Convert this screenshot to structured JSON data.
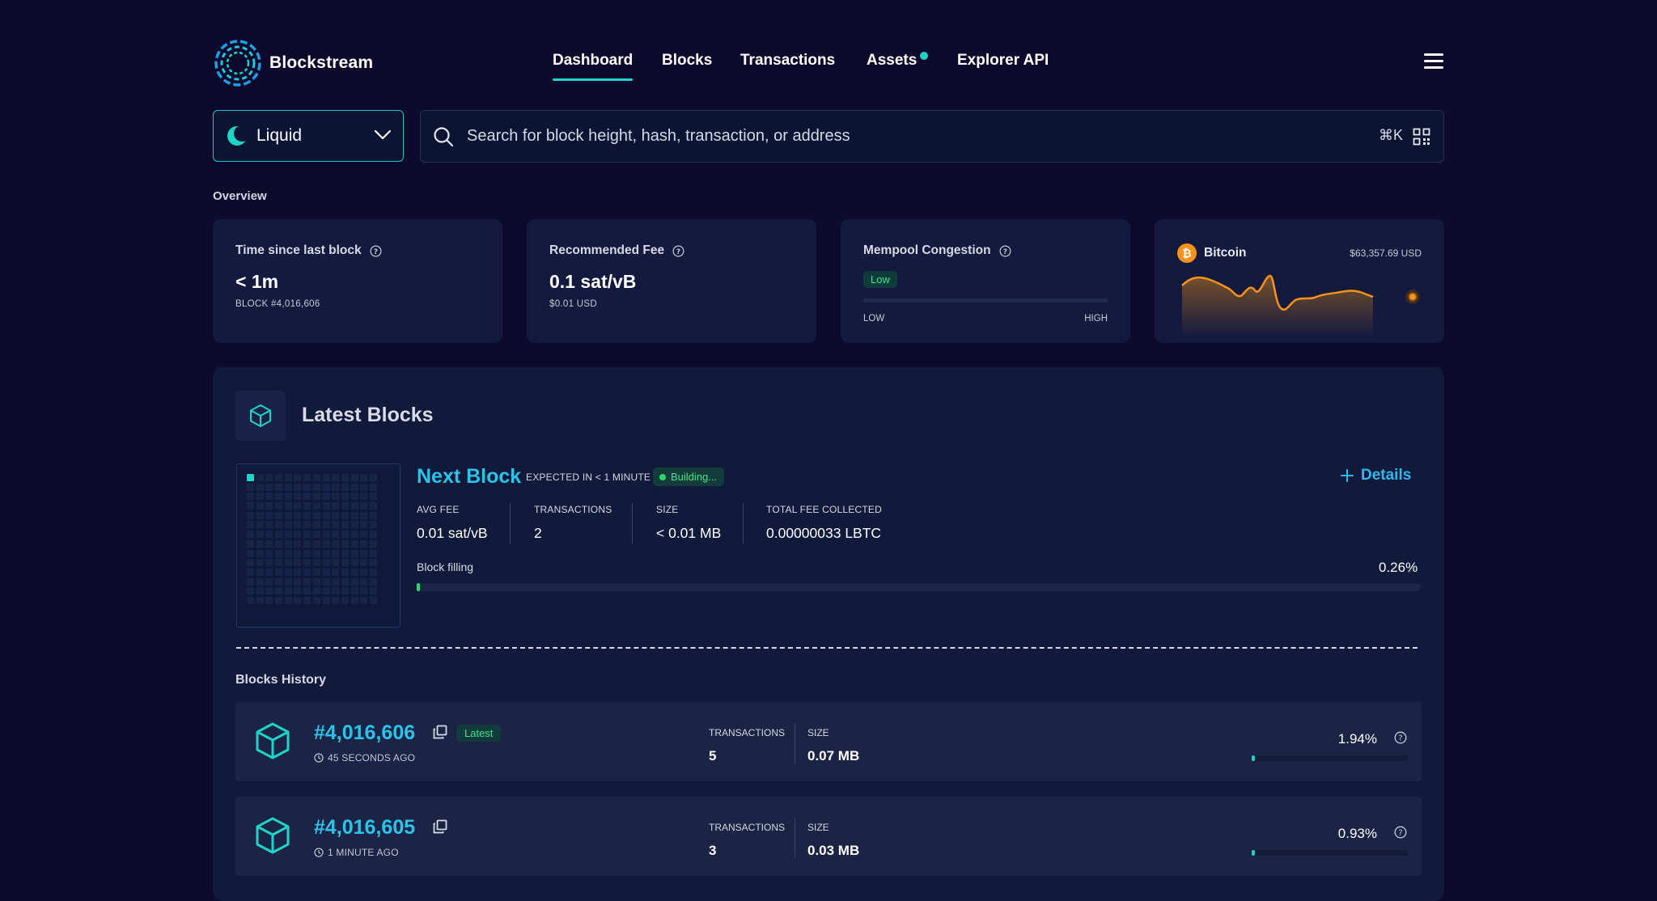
{
  "brand": {
    "name": "Blockstream"
  },
  "nav": {
    "items": [
      "Dashboard",
      "Blocks",
      "Transactions",
      "Assets",
      "Explorer API"
    ],
    "active": "Dashboard"
  },
  "network": {
    "selected": "Liquid"
  },
  "search": {
    "placeholder": "Search for block height, hash, transaction, or address",
    "shortcut": "⌘K"
  },
  "overview": {
    "title": "Overview",
    "cards": {
      "time_since": {
        "title": "Time since last block",
        "value": "< 1m",
        "sub": "BLOCK #4,016,606"
      },
      "fee": {
        "title": "Recommended Fee",
        "value": "0.1 sat/vB",
        "sub": "$0.01 USD"
      },
      "mempool": {
        "title": "Mempool Congestion",
        "badge": "Low",
        "low": "LOW",
        "high": "HIGH",
        "level": 0
      },
      "bitcoin": {
        "title": "Bitcoin",
        "price": "$63,357.69 USD"
      }
    }
  },
  "latest_blocks": {
    "title": "Latest Blocks",
    "next_block": {
      "title": "Next Block",
      "expected": "EXPECTED IN < 1 MINUTE",
      "status": "Building...",
      "details": "Details",
      "stats": [
        {
          "label": "AVG FEE",
          "value": "0.01 sat/vB"
        },
        {
          "label": "TRANSACTIONS",
          "value": "2"
        },
        {
          "label": "SIZE",
          "value": "< 0.01 MB"
        },
        {
          "label": "TOTAL FEE COLLECTED",
          "value": "0.00000033 LBTC"
        }
      ],
      "filling_label": "Block filling",
      "filling_value": "0.26%",
      "filling_percent": 0.26
    },
    "history_title": "Blocks History",
    "history": [
      {
        "height": "#4,016,606",
        "badge": "Latest",
        "time": "45 SECONDS AGO",
        "tx_label": "TRANSACTIONS",
        "tx": "5",
        "size_label": "SIZE",
        "size": "0.07 MB",
        "percent_text": "1.94%",
        "percent": 1.94
      },
      {
        "height": "#4,016,605",
        "badge": "",
        "time": "1 MINUTE AGO",
        "tx_label": "TRANSACTIONS",
        "tx": "3",
        "size_label": "SIZE",
        "size": "0.03 MB",
        "percent_text": "0.93%",
        "percent": 0.93
      }
    ]
  },
  "colors": {
    "accent": "#1fd3c6",
    "link": "#2ac4ea",
    "green": "#2dd86f",
    "bitcoin": "#f7931a",
    "background": "#0e0a2b",
    "card": "#131a3d"
  }
}
